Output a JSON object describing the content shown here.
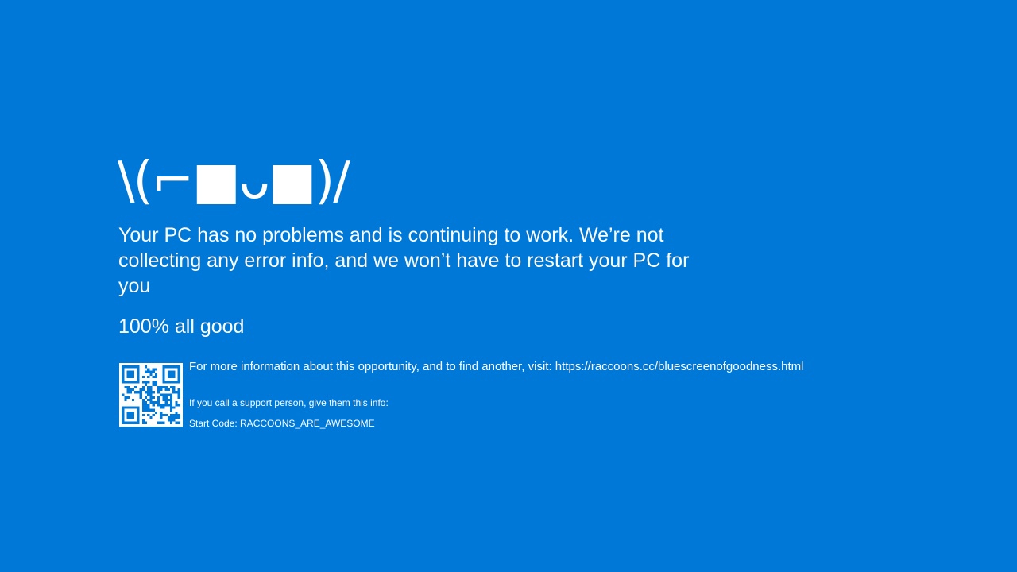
{
  "emoticon": "\\(⌐■ᴗ■)/",
  "message": "Your PC has no problems and is continuing to work.  We’re not collecting any error info, and we won’t have to restart your PC for you",
  "progress_text": "100% all good",
  "progress_percent": 100,
  "qr_code_icon": "qr-code",
  "info_text": "For more information about this opportunity, and to find another, visit: https://raccoons.cc/bluescreenofgoodness.html",
  "support_text": "If you call a support person, give them this info:",
  "start_code": "Start Code: RACCOONS_ARE_AWESOME",
  "colors": {
    "background": "#0078d7",
    "text": "#ffffff"
  }
}
